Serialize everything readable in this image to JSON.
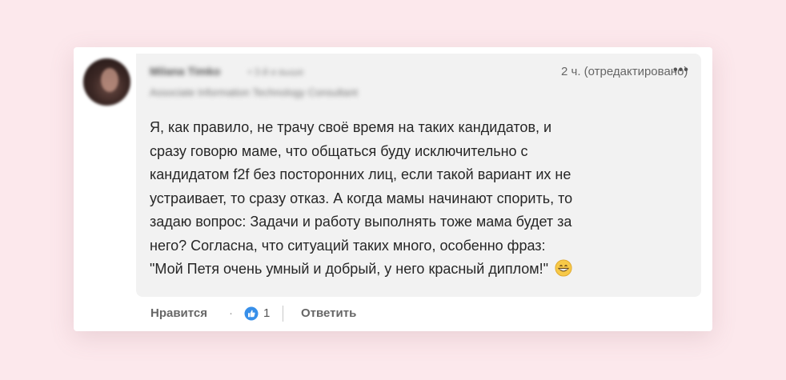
{
  "author": {
    "name": "Milana Timko",
    "degree": "• 3-й и выше",
    "headline": "Associate Information Technology Consultant"
  },
  "meta": {
    "timestamp": "2 ч. (отредактировано)",
    "more_icon": "•••"
  },
  "comment": {
    "lines": [
      "Я, как правило, не трачу своё время на таких кандидатов, и",
      "сразу говорю маме, что общаться буду исключительно с",
      "кандидатом f2f без посторонних лиц, если такой вариант их не",
      "устраивает, то сразу отказ. А когда мамы начинают спорить, то",
      "задаю вопрос: Задачи и работу выполнять тоже мама будет за",
      "него? Согласна, что ситуаций таких много, особенно фраз:",
      "\"Мой Петя очень умный и добрый, у него красный диплом!\""
    ],
    "emoji": "grinning-face-icon"
  },
  "actions": {
    "like_label": "Нравится",
    "separator": "·",
    "reaction_icon": "thumbs-up-icon",
    "reaction_count": "1",
    "reply_label": "Ответить"
  },
  "colors": {
    "page_background": "#fce8ec",
    "bubble_background": "#f2f2f2",
    "like_blue": "#0a66c2"
  }
}
